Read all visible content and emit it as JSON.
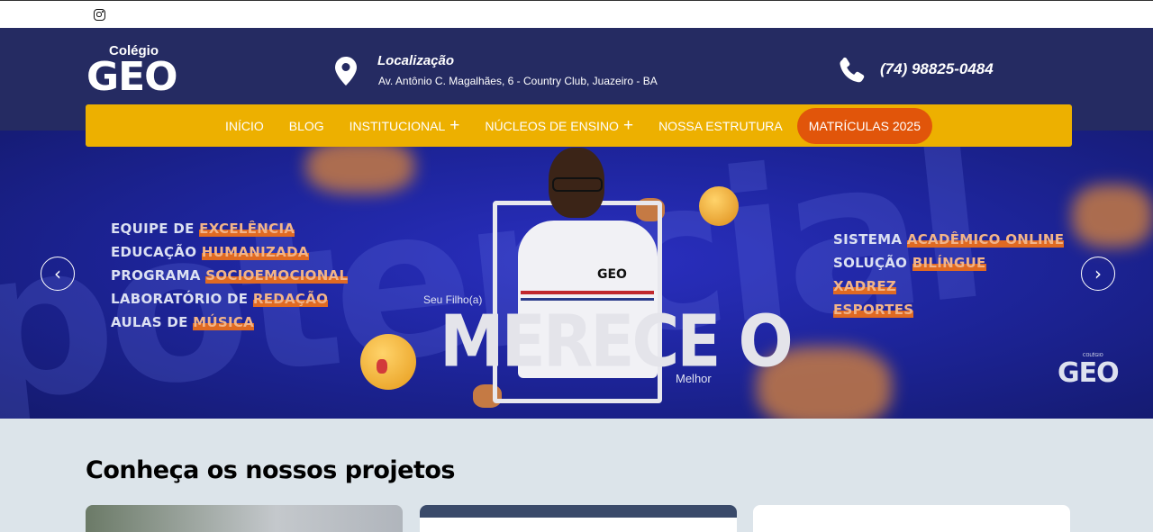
{
  "topbar": {
    "social_icon": "instagram-icon"
  },
  "header": {
    "logo_small": "Colégio",
    "logo_big": "GEO",
    "location_title": "Localização",
    "location_address": "Av. Antônio C. Magalhães, 6 - Country Club, Juazeiro - BA",
    "phone": "(74) 98825-0484"
  },
  "nav": {
    "items": [
      {
        "label": "INÍCIO"
      },
      {
        "label": "BLOG"
      },
      {
        "label": "INSTITUCIONAL",
        "plus": "+"
      },
      {
        "label": "NÚCLEOS DE ENSINO",
        "plus": "+"
      },
      {
        "label": "NOSSA ESTRUTURA"
      }
    ],
    "cta": "MATRÍCULAS 2025"
  },
  "hero": {
    "left_lines": [
      {
        "pre": "EQUIPE DE ",
        "hl": "EXCELÊNCIA"
      },
      {
        "pre": "EDUCAÇÃO ",
        "hl": "HUMANIZADA"
      },
      {
        "pre": "PROGRAMA ",
        "hl": "SOCIOEMOCIONAL"
      },
      {
        "pre": "LABORATÓRIO DE ",
        "hl": "REDAÇÃO"
      },
      {
        "pre": "AULAS DE ",
        "hl": "MÚSICA"
      }
    ],
    "right_lines": [
      {
        "pre": "SISTEMA ",
        "hl": "ACADÊMICO ONLINE"
      },
      {
        "pre": "SOLUÇÃO ",
        "hl": "BILÍNGUE"
      },
      {
        "pre": "",
        "hl": "XADREZ"
      },
      {
        "pre": "",
        "hl": "ESPORTES"
      }
    ],
    "seu_filho": "Seu Filho(a)",
    "merece": "MERECE O",
    "melhor": "Melhor",
    "shirt_logo": "GEO",
    "brand_small": "COLÉGIO",
    "brand": "GEO",
    "prev_arrow": "‹",
    "next_arrow": "›"
  },
  "section": {
    "title": "Conheça os nossos projetos"
  }
}
